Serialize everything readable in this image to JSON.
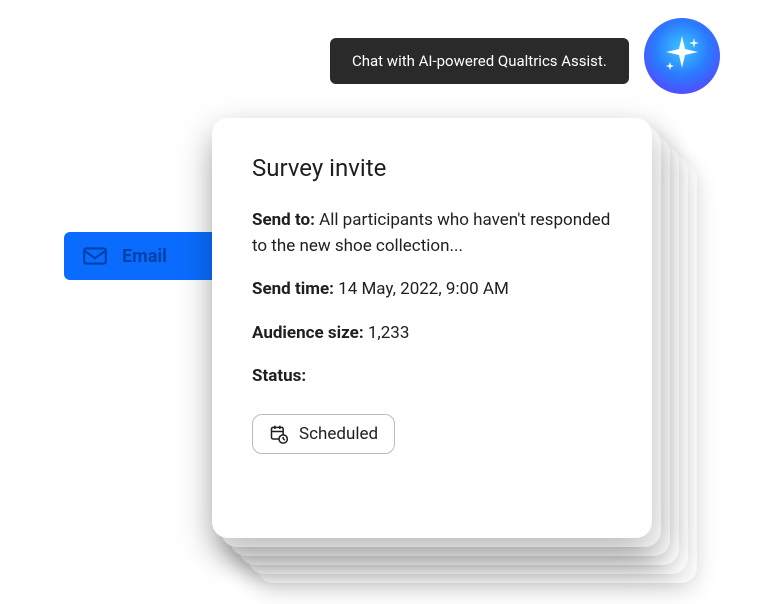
{
  "tooltip": {
    "text": "Chat with AI-powered Qualtrics Assist."
  },
  "emailTab": {
    "label": "Email"
  },
  "card": {
    "title": "Survey invite",
    "sendTo": {
      "label": "Send to:",
      "value": "All participants who haven't responded to the new shoe collection..."
    },
    "sendTime": {
      "label": "Send time:",
      "value": "14 May, 2022, 9:00 AM"
    },
    "audienceSize": {
      "label": "Audience size:",
      "value": "1,233"
    },
    "status": {
      "label": "Status:",
      "chip": "Scheduled"
    }
  }
}
